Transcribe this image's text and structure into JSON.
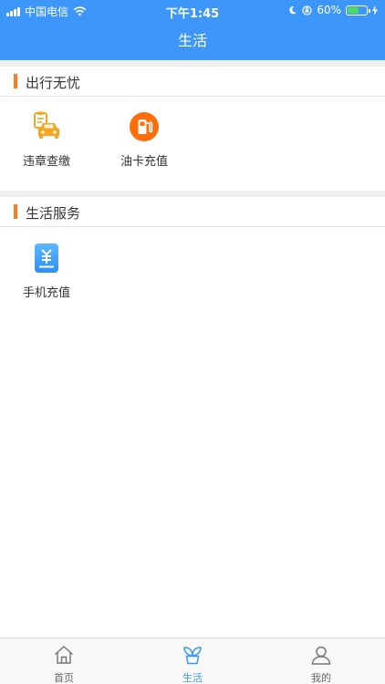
{
  "status_bar": {
    "carrier": "中国电信",
    "time": "下午1:45",
    "battery_percent": "60%",
    "battery_level": 0.6
  },
  "header": {
    "title": "生活"
  },
  "sections": [
    {
      "title": "出行无忧",
      "items": [
        {
          "label": "违章查缴",
          "icon": "car-ticket-icon"
        },
        {
          "label": "油卡充值",
          "icon": "fuel-pump-icon"
        }
      ]
    },
    {
      "title": "生活服务",
      "items": [
        {
          "label": "手机充值",
          "icon": "phone-recharge-icon"
        }
      ]
    }
  ],
  "tabbar": {
    "tabs": [
      {
        "label": "首页",
        "icon": "home-icon",
        "active": false
      },
      {
        "label": "生活",
        "icon": "sprout-icon",
        "active": true
      },
      {
        "label": "我的",
        "icon": "user-icon",
        "active": false
      }
    ]
  },
  "colors": {
    "primary": "#3d97fb",
    "accent": "#ff7a1a",
    "background": "#ffffff"
  }
}
